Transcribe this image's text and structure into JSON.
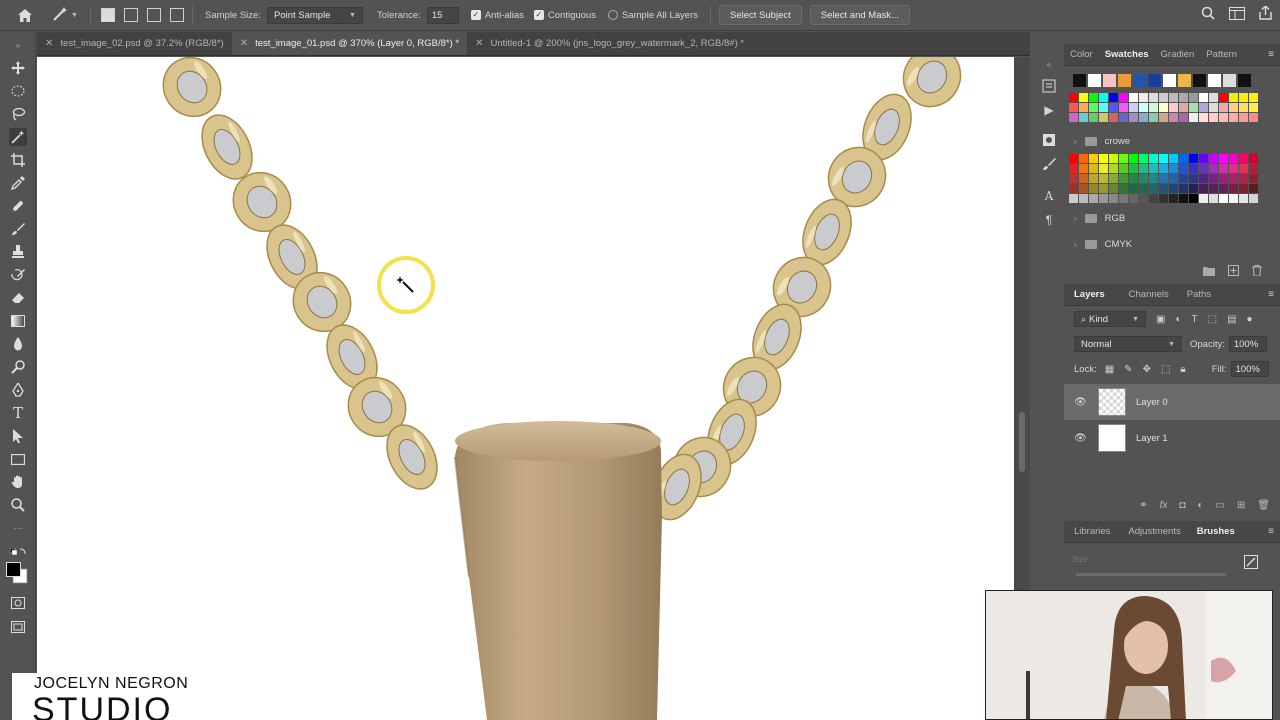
{
  "options_bar": {
    "sample_size_label": "Sample Size:",
    "sample_size_value": "Point Sample",
    "tolerance_label": "Tolerance:",
    "tolerance_value": "15",
    "anti_alias_label": "Anti-alias",
    "contiguous_label": "Contiguous",
    "sample_all_layers_label": "Sample All Layers",
    "select_subject_label": "Select Subject",
    "select_and_mask_label": "Select and Mask..."
  },
  "tabs": [
    {
      "label": "test_image_02.psd @ 37.2% (RGB/8*)",
      "active": false
    },
    {
      "label": "test_image_01.psd @ 370% (Layer 0, RGB/8*) *",
      "active": true
    },
    {
      "label": "Untitled-1 @ 200% (jns_logo_grey_watermark_2, RGB/8#) *",
      "active": false
    }
  ],
  "swatches_panel": {
    "tabs": [
      "Color",
      "Swatches",
      "Gradien",
      "Pattern"
    ],
    "active_tab": "Swatches",
    "folders": [
      "crowe",
      "RGB",
      "CMYK"
    ]
  },
  "layers_panel": {
    "tabs": [
      "Layers",
      "Channels",
      "Paths"
    ],
    "filter_label": "Kind",
    "blend_mode": "Normal",
    "opacity_label": "Opacity:",
    "opacity_value": "100%",
    "lock_label": "Lock:",
    "fill_label": "Fill:",
    "fill_value": "100%",
    "layers": [
      {
        "name": "Layer 0",
        "selected": true,
        "thumb": "transparent"
      },
      {
        "name": "Layer 1",
        "selected": false,
        "thumb": "white"
      }
    ]
  },
  "bottom_panel": {
    "tabs": [
      "Libraries",
      "Adjustments",
      "Brushes"
    ],
    "active_tab": "Brushes",
    "size_label": "Size:"
  },
  "watermark": {
    "line1": "JOCELYN NEGRON",
    "line2": "STUDIO"
  },
  "colors": {
    "chain_gold": "#d8c48c",
    "bail_bronze": "#b59a74",
    "cursor_ring": "#f2e14a"
  }
}
